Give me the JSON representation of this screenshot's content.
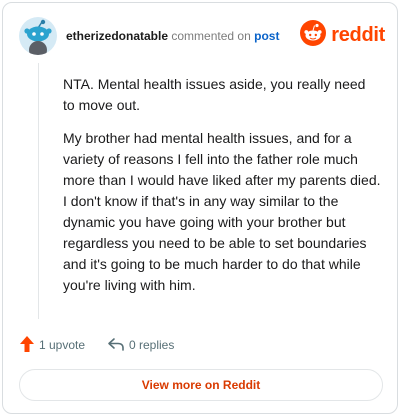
{
  "comment": {
    "username": "etherizedonatable",
    "action_text": "commented on",
    "post_link_label": "post",
    "paragraphs": [
      "NTA. Mental health issues aside, you really need to move out.",
      "My brother had mental health issues, and for a variety of reasons I fell into the father role much more than I would have liked after my parents died. I don't know if that's in any way similar to the dynamic you have going with your brother but regardless you need to be able to set boundaries and it's going to be much harder to do that while you're living with him."
    ]
  },
  "brand": {
    "name": "reddit",
    "color": "#ff4500"
  },
  "footer": {
    "upvotes_label": "1 upvote",
    "replies_label": "0 replies",
    "view_more_label": "View more on Reddit"
  },
  "icons": {
    "avatar": "snoo-avatar-icon",
    "logo": "reddit-logo-icon",
    "upvote": "upvote-arrow-icon",
    "reply": "reply-arrow-icon"
  },
  "colors": {
    "link": "#0a63c9",
    "upvote": "#ff4500",
    "view_more": "#d93a00"
  }
}
